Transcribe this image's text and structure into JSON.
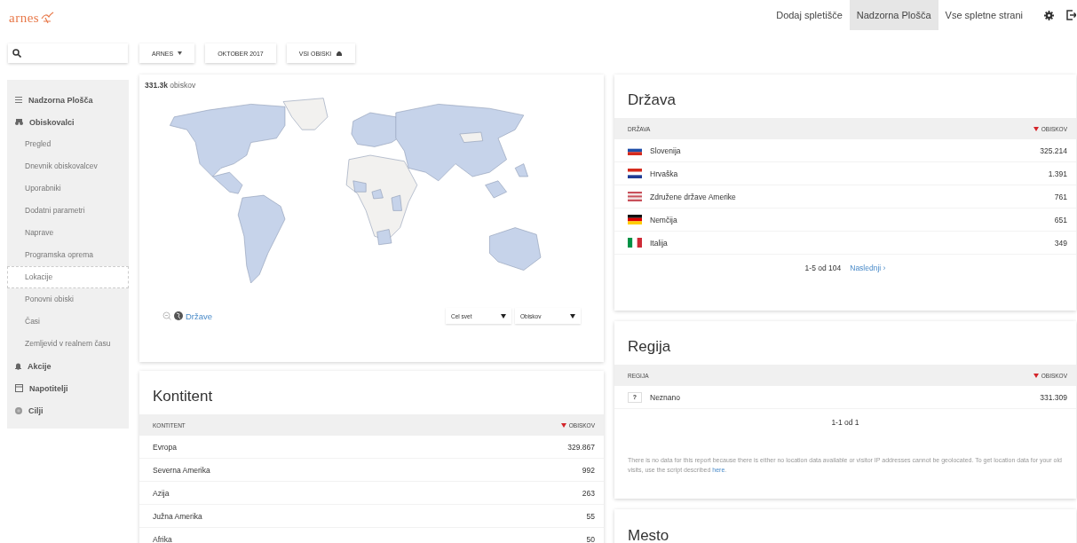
{
  "logo": {
    "text": "arnes"
  },
  "nav": [
    {
      "label": "Dodaj spletišče",
      "selected": false
    },
    {
      "label": "Nadzorna Plošča",
      "selected": true
    },
    {
      "label": "Vse spletne strani",
      "selected": false
    }
  ],
  "filters": [
    {
      "label": "ARNES",
      "kind": "dropdown"
    },
    {
      "label": "OKTOBER 2017",
      "kind": "plain"
    },
    {
      "label": "VSI OBISKI",
      "kind": "segment"
    }
  ],
  "sidebar": {
    "items": [
      {
        "label": "Nadzorna Plošča",
        "selected": false
      },
      {
        "label": "Obiskovalci",
        "selected": false,
        "children": [
          {
            "label": "Pregled",
            "selected": false
          },
          {
            "label": "Dnevnik obiskovalcev",
            "selected": false
          },
          {
            "label": "Uporabniki",
            "selected": false
          },
          {
            "label": "Dodatni parametri",
            "selected": false
          },
          {
            "label": "Naprave",
            "selected": false
          },
          {
            "label": "Programska oprema",
            "selected": false
          },
          {
            "label": "Lokacije",
            "selected": true
          },
          {
            "label": "Ponovni obiski",
            "selected": false
          },
          {
            "label": "Časi",
            "selected": false
          },
          {
            "label": "Zemljevid v realnem času",
            "selected": false
          }
        ]
      },
      {
        "label": "Akcije",
        "selected": false
      },
      {
        "label": "Napotitelji",
        "selected": false
      },
      {
        "label": "Cilji",
        "selected": false
      }
    ]
  },
  "map": {
    "total": "**331.3k** obiskov",
    "level_link": "Države",
    "selects": [
      "Cel svet",
      "Obiskov"
    ]
  },
  "continent_card": {
    "title": "Kontitent",
    "columns": [
      {
        "label": "KONTITENT",
        "sorted": false
      },
      {
        "label": "OBISKOV",
        "sorted": true
      }
    ],
    "rows": [
      {
        "name": "Evropa",
        "value": "329.867"
      },
      {
        "name": "Severna Amerika",
        "value": "992"
      },
      {
        "name": "Azija",
        "value": "263"
      },
      {
        "name": "Južna Amerika",
        "value": "55"
      },
      {
        "name": "Afrika",
        "value": "50"
      }
    ]
  },
  "country_card": {
    "title": "Država",
    "columns": [
      {
        "label": "DRŽAVA",
        "sorted": false
      },
      {
        "label": "OBISKOV",
        "sorted": true
      }
    ],
    "rows": [
      {
        "name": "Slovenija",
        "value": "325.214"
      },
      {
        "name": "Hrvaška",
        "value": "1.391"
      },
      {
        "name": "Združene države Amerike",
        "value": "761"
      },
      {
        "name": "Nemčija",
        "value": "651"
      },
      {
        "name": "Italija",
        "value": "349"
      }
    ],
    "pagination": {
      "range": "1-5 od 104",
      "next": "Naslednji ›"
    }
  },
  "region_card": {
    "title": "Regija",
    "columns": [
      {
        "label": "REGIJA",
        "sorted": false
      },
      {
        "label": "OBISKOV",
        "sorted": true
      }
    ],
    "rows": [
      {
        "badge": "?",
        "name": "Neznano",
        "value": "331.309"
      }
    ],
    "pagination": {
      "range": "1-1 od 1"
    },
    "note": {
      "text": "There is no data for this report because there is either no location data available or visitor IP addresses cannot be geolocated. To get location data for your old visits, use the script described ",
      "link": "here",
      "end": "."
    }
  },
  "city_card": {
    "title": "Mesto"
  }
}
